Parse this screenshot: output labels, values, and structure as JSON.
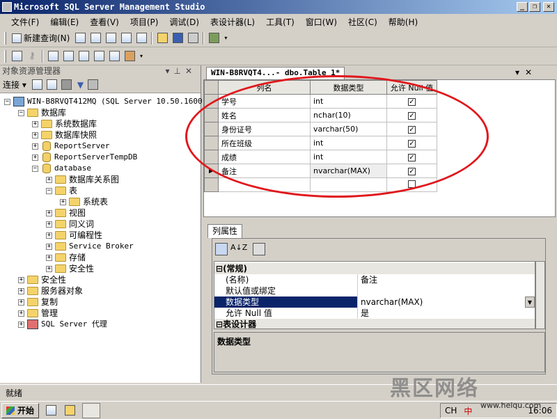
{
  "window": {
    "title": "Microsoft SQL Server Management Studio",
    "min": "_",
    "max": "❐",
    "close": "✕"
  },
  "menu": [
    "文件(F)",
    "编辑(E)",
    "查看(V)",
    "项目(P)",
    "调试(D)",
    "表设计器(L)",
    "工具(T)",
    "窗口(W)",
    "社区(C)",
    "帮助(H)"
  ],
  "toolbar": {
    "new_query": "新建查询(N)"
  },
  "object_explorer": {
    "title": "对象资源管理器",
    "connect": "连接",
    "server": "WIN-B8RVQT412MQ (SQL Server 10.50.1600 -",
    "nodes": {
      "databases": "数据库",
      "system_dbs": "系统数据库",
      "snapshots": "数据库快照",
      "report_server": "ReportServer",
      "report_server_temp": "ReportServerTempDB",
      "database": "database",
      "diagrams": "数据库关系图",
      "tables": "表",
      "system_tables": "系统表",
      "views": "视图",
      "synonyms": "同义词",
      "programmability": "可编程性",
      "service_broker": "Service Broker",
      "storage": "存储",
      "db_security": "安全性",
      "security": "安全性",
      "server_objects": "服务器对象",
      "replication": "复制",
      "management": "管理",
      "agent": "SQL Server 代理"
    }
  },
  "designer": {
    "tab_title": "WIN-B8RVQT4...- dbo.Table_1*",
    "headers": {
      "name": "列名",
      "type": "数据类型",
      "nullable": "允许 Null 值"
    },
    "rows": [
      {
        "name": "学号",
        "type": "int",
        "nullable": "✓"
      },
      {
        "name": "姓名",
        "type": "nchar(10)",
        "nullable": "✓"
      },
      {
        "name": "身份证号",
        "type": "varchar(50)",
        "nullable": "✓"
      },
      {
        "name": "所在班级",
        "type": "int",
        "nullable": "✓"
      },
      {
        "name": "成绩",
        "type": "int",
        "nullable": "✓"
      },
      {
        "name": "备注",
        "type": "nvarchar(MAX)",
        "nullable": "✓"
      },
      {
        "name": "",
        "type": "",
        "nullable": ""
      }
    ]
  },
  "column_properties": {
    "tab": "列属性",
    "section_general": "(常规)",
    "props": [
      {
        "name": "(名称)",
        "value": "备注"
      },
      {
        "name": "默认值或绑定",
        "value": ""
      },
      {
        "name": "数据类型",
        "value": "nvarchar(MAX)"
      },
      {
        "name": "允许 Null 值",
        "value": "是"
      }
    ],
    "section_designer": "表设计器",
    "description_title": "数据类型"
  },
  "status": {
    "text": "就绪"
  },
  "taskbar": {
    "start": "开始",
    "ime": "CH",
    "ime_mode": "中",
    "clock": "16:06"
  },
  "watermark": {
    "text": "黑区网络",
    "url": "www.heiqu.com"
  }
}
